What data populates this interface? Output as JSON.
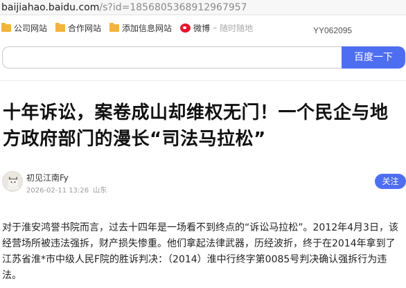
{
  "browser": {
    "url_host": "baijiahao.baidu.com",
    "url_path": "/s?id=1856805368912967957"
  },
  "bookmarks": [
    {
      "icon": "folder-icon",
      "label": "公司网站"
    },
    {
      "icon": "folder-icon",
      "label": "合作网站"
    },
    {
      "icon": "folder-icon",
      "label": "添加信息网站"
    },
    {
      "icon": "weibo-icon",
      "label": "微博",
      "extra": "随时随地"
    }
  ],
  "bookmark_sep": "–",
  "user_id": "YY062095",
  "search": {
    "placeholder": "",
    "button_label": "百度一下"
  },
  "article": {
    "title": "十年诉讼，案卷成山却维权无门！一个民企与地方政府部门的漫长“司法马拉松”",
    "author": "初见江南Fy",
    "datetime": "2026-02-11 13:26",
    "location": "山东",
    "follow_label": "关注",
    "paragraph": "对于淮安鸿誉书院而言，过去十四年是一场看不到终点的“诉讼马拉松”。2012年4月3日，该经营场所被违法强拆，财产损失惨重。他们拿起法律武器，历经波折，终于在2014年拿到了江苏省淮*市中级人民F院的胜诉判决：（2014）淮中行终字第0085号判决确认强拆行为违法。"
  },
  "colors": {
    "accent": "#4e6ef2",
    "folder": "#f2b43c",
    "weibo": "#e6162d"
  }
}
